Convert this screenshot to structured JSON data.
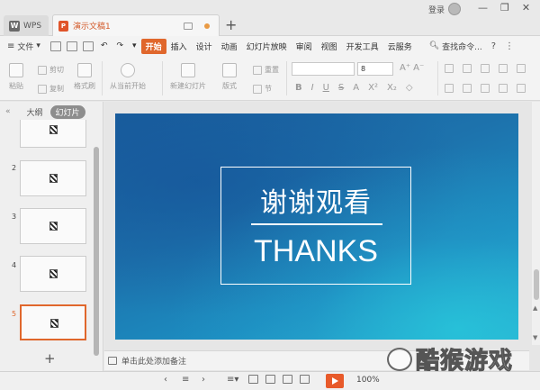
{
  "titlebar": {
    "wps_tab": "WPS",
    "doc_tab": "演示文稿1",
    "new_tab": "+",
    "login": "登录",
    "min": "—",
    "restore": "❐",
    "close": "✕"
  },
  "menu": {
    "file": "文件",
    "tabs": [
      "开始",
      "插入",
      "设计",
      "动画",
      "幻灯片放映",
      "审阅",
      "视图",
      "开发工具",
      "云服务"
    ],
    "search": "查找命令...",
    "help": "?",
    "more": "⋮"
  },
  "ribbon": {
    "paste": "粘贴",
    "cut": "剪切",
    "copy": "复制",
    "format_painter": "格式刷",
    "play_from_current": "从当前开始",
    "new_slide": "新建幻灯片",
    "layout": "版式",
    "section": "节",
    "reset": "重置",
    "font_size": "8",
    "bold": "B",
    "italic": "I",
    "underline": "U",
    "strike": "S",
    "shadow": "A",
    "superscript": "X²",
    "subscript": "X₂",
    "clear": "◇",
    "grow": "A⁺",
    "shrink": "A⁻"
  },
  "left_panel": {
    "collapse": "«",
    "outline_tab": "大纲",
    "slides_tab": "幻灯片",
    "slide_numbers": [
      "2",
      "3",
      "4",
      "5"
    ],
    "add": "+"
  },
  "slide": {
    "title_zh": "谢谢观看",
    "title_en": "THANKS"
  },
  "notes": {
    "placeholder": "单击此处添加备注"
  },
  "status": {
    "zoom": "100%",
    "zoom_minus": "−",
    "zoom_plus": "+"
  },
  "watermark": {
    "text": "酷猴游戏"
  }
}
